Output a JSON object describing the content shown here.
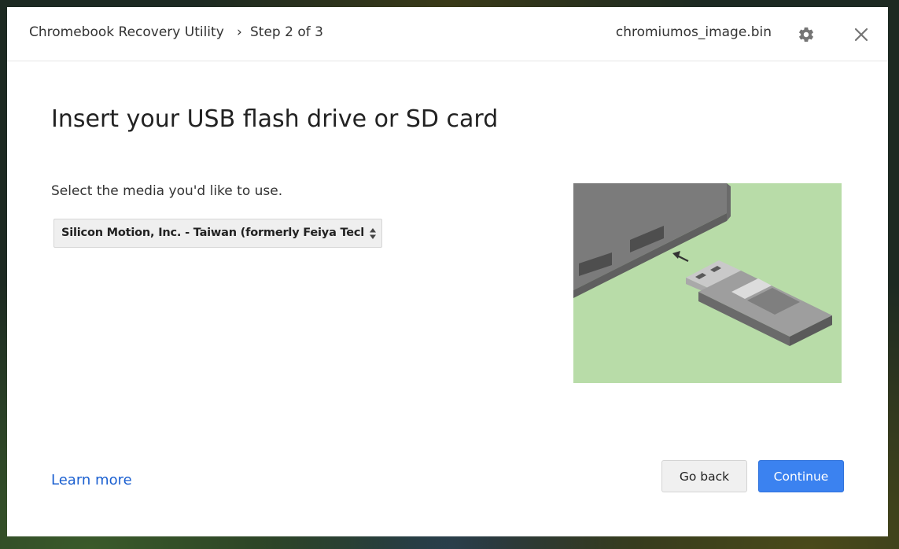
{
  "header": {
    "app_title": "Chromebook Recovery Utility",
    "separator": "›",
    "step": "Step 2 of 3",
    "file_name": "chromiumos_image.bin"
  },
  "icons": {
    "settings": "gear-icon",
    "close": "close-icon",
    "select_arrows": "up-down-arrows-icon"
  },
  "main": {
    "heading": "Insert your USB flash drive or SD card",
    "prompt": "Select the media you'd like to use.",
    "media_select": {
      "selected": "Silicon Motion, Inc. - Taiwan (formerly Feiya Technology Corp.)"
    }
  },
  "footer": {
    "learn_more": "Learn more",
    "back_label": "Go back",
    "continue_label": "Continue"
  },
  "colors": {
    "accent": "#3b82f0",
    "link": "#1a5fd0",
    "illustration_bg": "#b8dca8"
  }
}
